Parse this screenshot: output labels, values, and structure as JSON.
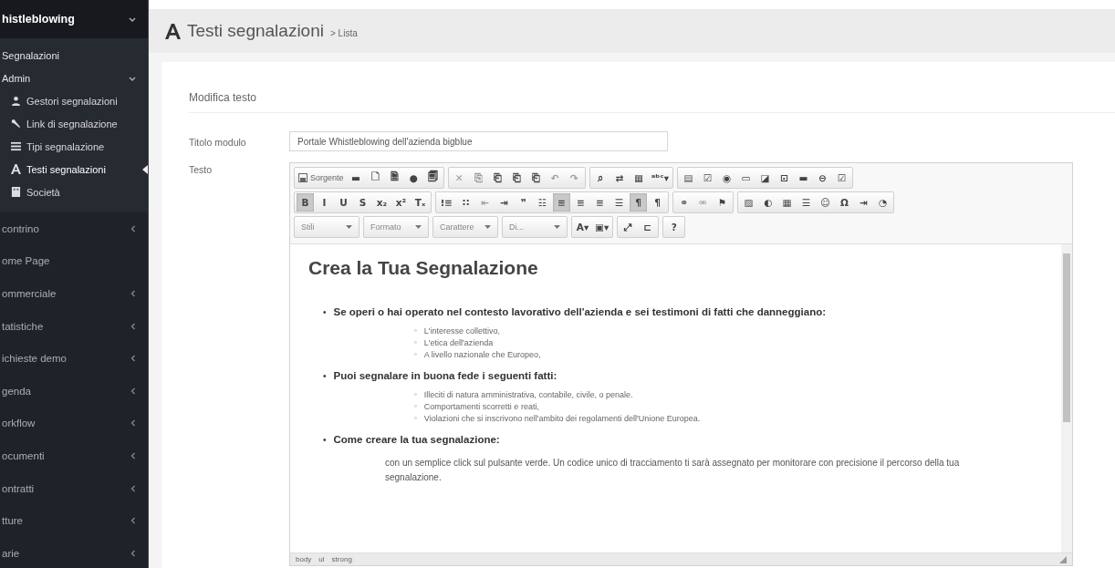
{
  "sidebar": {
    "header": {
      "label": "histleblowing",
      "expanded": true
    },
    "submenu": [
      {
        "label": "Segnalazioni"
      },
      {
        "label": "Admin",
        "expanded": true,
        "children": [
          {
            "label": "Gestori segnalazioni",
            "selected": false
          },
          {
            "label": "Link di segnalazione",
            "selected": false
          },
          {
            "label": "Tipi segnalazione",
            "selected": false
          },
          {
            "label": "Testi segnalazioni",
            "selected": true
          },
          {
            "label": "Società",
            "selected": false
          }
        ]
      }
    ],
    "items": [
      {
        "label": "contrino",
        "expandable": true
      },
      {
        "label": "ome Page",
        "expandable": false
      },
      {
        "label": "ommerciale",
        "expandable": true
      },
      {
        "label": "tatistiche",
        "expandable": true
      },
      {
        "label": "ichieste demo",
        "expandable": true
      },
      {
        "label": "genda",
        "expandable": true
      },
      {
        "label": "orkflow",
        "expandable": true
      },
      {
        "label": "ocumenti",
        "expandable": true
      },
      {
        "label": "ontratti",
        "expandable": true
      },
      {
        "label": "tture",
        "expandable": true
      },
      {
        "label": "arie",
        "expandable": true
      }
    ]
  },
  "page": {
    "title": "Testi segnalazioni",
    "breadcrumb": "> Lista"
  },
  "panel": {
    "title": "Modifica testo",
    "fields": [
      {
        "label": "Titolo modulo",
        "value": "Portale Whistleblowing dell'azienda bigblue"
      }
    ],
    "editor_label": "Testo"
  },
  "toolbar": {
    "lines": [
      {
        "groups": [
          {
            "buttons": [
              {
                "kind": "labeled",
                "text": "Sorgente",
                "selected": false,
                "disabled": false
              },
              {
                "kind": "glyph",
                "text": "▬",
                "selected": false,
                "disabled": false
              },
              {
                "kind": "glyph",
                "text": "🗋",
                "selected": false,
                "disabled": false
              },
              {
                "kind": "glyph",
                "text": "🗎",
                "selected": false,
                "disabled": false
              },
              {
                "kind": "glyph",
                "text": "●",
                "selected": false,
                "disabled": false
              },
              {
                "kind": "glyph",
                "text": "🗐",
                "selected": false,
                "disabled": false
              }
            ]
          },
          {
            "buttons": [
              {
                "kind": "glyph",
                "text": "✕",
                "selected": false,
                "disabled": true
              },
              {
                "kind": "glyph",
                "text": "⎘",
                "selected": false,
                "disabled": true
              },
              {
                "kind": "glyph",
                "text": "⎗",
                "selected": false,
                "disabled": false
              },
              {
                "kind": "glyph",
                "text": "⎗",
                "selected": false,
                "disabled": false
              },
              {
                "kind": "glyph",
                "text": "⎗",
                "selected": false,
                "disabled": false
              },
              {
                "kind": "glyph",
                "text": "↶",
                "selected": false,
                "disabled": true
              },
              {
                "kind": "glyph",
                "text": "↷",
                "selected": false,
                "disabled": true
              }
            ]
          },
          {
            "buttons": [
              {
                "kind": "glyph",
                "text": "⌕",
                "selected": false,
                "disabled": false
              },
              {
                "kind": "glyph",
                "text": "⇄",
                "selected": false,
                "disabled": false
              },
              {
                "kind": "glyph",
                "text": "▦",
                "selected": false,
                "disabled": false
              },
              {
                "kind": "glyph",
                "text": "ᵃᵇᶜ▾",
                "selected": false,
                "disabled": false
              }
            ]
          },
          {
            "buttons": [
              {
                "kind": "glyph",
                "text": "▤",
                "selected": false,
                "disabled": false
              },
              {
                "kind": "glyph",
                "text": "☑",
                "selected": false,
                "disabled": false
              },
              {
                "kind": "glyph",
                "text": "◉",
                "selected": false,
                "disabled": false
              },
              {
                "kind": "glyph",
                "text": "▭",
                "selected": false,
                "disabled": false
              },
              {
                "kind": "glyph",
                "text": "◪",
                "selected": false,
                "disabled": false
              },
              {
                "kind": "glyph",
                "text": "⊡",
                "selected": false,
                "disabled": false
              },
              {
                "kind": "glyph",
                "text": "▬",
                "selected": false,
                "disabled": false
              },
              {
                "kind": "glyph",
                "text": "⊖",
                "selected": false,
                "disabled": false
              },
              {
                "kind": "glyph",
                "text": "☑",
                "selected": false,
                "disabled": false
              }
            ]
          }
        ]
      },
      {
        "groups": [
          {
            "buttons": [
              {
                "kind": "glyph",
                "text": "B",
                "selected": true,
                "disabled": false
              },
              {
                "kind": "glyph",
                "text": "I",
                "selected": false,
                "disabled": false
              },
              {
                "kind": "glyph",
                "text": "U",
                "selected": false,
                "disabled": false
              },
              {
                "kind": "glyph",
                "text": "S",
                "selected": false,
                "disabled": false
              },
              {
                "kind": "glyph",
                "text": "x₂",
                "selected": false,
                "disabled": false
              },
              {
                "kind": "glyph",
                "text": "x²",
                "selected": false,
                "disabled": false
              },
              {
                "kind": "glyph",
                "text": "Tₓ",
                "selected": false,
                "disabled": false
              }
            ]
          },
          {
            "buttons": [
              {
                "kind": "glyph",
                "text": "⁝≡",
                "selected": false,
                "disabled": false
              },
              {
                "kind": "glyph",
                "text": "∷",
                "selected": false,
                "disabled": false
              },
              {
                "kind": "glyph",
                "text": "⇤",
                "selected": false,
                "disabled": true
              },
              {
                "kind": "glyph",
                "text": "⇥",
                "selected": false,
                "disabled": false
              },
              {
                "kind": "glyph",
                "text": "❞",
                "selected": false,
                "disabled": false
              },
              {
                "kind": "glyph",
                "text": "☷",
                "selected": false,
                "disabled": false
              },
              {
                "kind": "glyph",
                "text": "≡",
                "selected": true,
                "disabled": false
              },
              {
                "kind": "glyph",
                "text": "≡",
                "selected": false,
                "disabled": false
              },
              {
                "kind": "glyph",
                "text": "≡",
                "selected": false,
                "disabled": false
              },
              {
                "kind": "glyph",
                "text": "☰",
                "selected": false,
                "disabled": false
              },
              {
                "kind": "glyph",
                "text": "¶",
                "selected": true,
                "disabled": false
              },
              {
                "kind": "glyph",
                "text": "¶",
                "selected": false,
                "disabled": false
              }
            ]
          },
          {
            "buttons": [
              {
                "kind": "glyph",
                "text": "⚭",
                "selected": false,
                "disabled": false
              },
              {
                "kind": "glyph",
                "text": "⚮",
                "selected": false,
                "disabled": true
              },
              {
                "kind": "glyph",
                "text": "⚑",
                "selected": false,
                "disabled": false
              }
            ]
          },
          {
            "buttons": [
              {
                "kind": "glyph",
                "text": "▨",
                "selected": false,
                "disabled": false
              },
              {
                "kind": "glyph",
                "text": "◐",
                "selected": false,
                "disabled": false
              },
              {
                "kind": "glyph",
                "text": "▦",
                "selected": false,
                "disabled": false
              },
              {
                "kind": "glyph",
                "text": "☰",
                "selected": false,
                "disabled": false
              },
              {
                "kind": "glyph",
                "text": "☺",
                "selected": false,
                "disabled": false
              },
              {
                "kind": "glyph",
                "text": "Ω",
                "selected": false,
                "disabled": false
              },
              {
                "kind": "glyph",
                "text": "⇥",
                "selected": false,
                "disabled": false
              },
              {
                "kind": "glyph",
                "text": "◔",
                "selected": false,
                "disabled": false
              }
            ]
          }
        ]
      },
      {
        "groups": [
          {
            "buttons": [
              {
                "kind": "combo",
                "text": "Stili",
                "selected": false,
                "disabled": false
              }
            ]
          },
          {
            "buttons": [
              {
                "kind": "combo",
                "text": "Formato",
                "selected": false,
                "disabled": false
              }
            ]
          },
          {
            "buttons": [
              {
                "kind": "combo",
                "text": "Carattere",
                "selected": false,
                "disabled": false
              }
            ]
          },
          {
            "buttons": [
              {
                "kind": "combo",
                "text": "Di...",
                "selected": false,
                "disabled": false
              }
            ]
          },
          {
            "buttons": [
              {
                "kind": "glyph",
                "text": "A▾",
                "selected": false,
                "disabled": false
              },
              {
                "kind": "glyph",
                "text": "▣▾",
                "selected": false,
                "disabled": false
              }
            ]
          },
          {
            "buttons": [
              {
                "kind": "glyph",
                "text": "⤢",
                "selected": false,
                "disabled": false
              },
              {
                "kind": "glyph",
                "text": "⊏",
                "selected": false,
                "disabled": false
              }
            ]
          },
          {
            "buttons": [
              {
                "kind": "glyph",
                "text": "?",
                "selected": false,
                "disabled": false
              }
            ]
          }
        ]
      }
    ]
  },
  "content": {
    "heading": "Crea la Tua Segnalazione",
    "bullet": "•",
    "sub_bullet": "◦",
    "sections": [
      {
        "title": "Se operi o hai operato nel contesto lavorativo dell'azienda e sei testimoni di fatti che danneggiano:",
        "items": [
          "L'interesse collettivo,",
          "L'etica dell'azienda",
          "A livello nazionale che Europeo,"
        ]
      },
      {
        "title": "Puoi segnalare in buona fede i seguenti fatti:",
        "items": [
          "Illeciti di natura amministrativa, contabile, civile, o penale.",
          "Comportamenti scorretti e reati,",
          "Violazioni che si inscrivono nell'ambito dei regolamenti dell'Unione Europea."
        ]
      },
      {
        "title": "Come creare la tua segnalazione:",
        "paragraph": "con un semplice click sul pulsante verde. Un codice unico di tracciamento ti sarà assegnato per monitorare con precisione il percorso della tua segnalazione."
      }
    ]
  },
  "path_bar": [
    "body",
    "ul",
    "strong"
  ]
}
